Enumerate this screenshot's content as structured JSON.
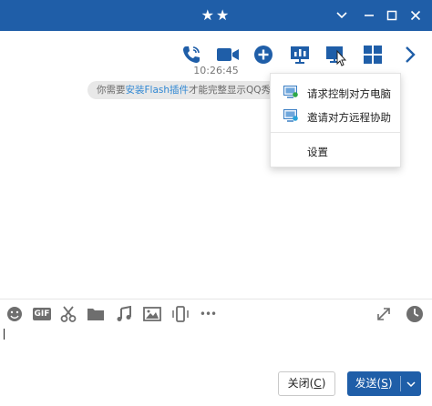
{
  "window": {
    "title": "★★"
  },
  "toolbar": {
    "icons": [
      "phone-icon",
      "video-call-icon",
      "add-icon",
      "presentation-icon",
      "remote-screen-icon",
      "apps-grid-icon",
      "chevron-right-icon"
    ]
  },
  "chat": {
    "timestamp": "10:26:45",
    "tip_prefix": "你需要",
    "tip_link": "安装Flash插件",
    "tip_suffix": "才能完整显示QQ秀"
  },
  "menu": {
    "items": [
      {
        "label": "请求控制对方电脑",
        "icon": "request-control-icon"
      },
      {
        "label": "邀请对方远程协助",
        "icon": "invite-assist-icon"
      },
      {
        "label": "设置"
      }
    ]
  },
  "input_toolbar": {
    "icons": [
      "emoji-icon",
      "gif-icon",
      "scissors-icon",
      "folder-icon",
      "music-icon",
      "image-icon",
      "shake-icon",
      "more-icon",
      "expand-icon",
      "history-clock-icon"
    ],
    "gif_label": "GIF",
    "more_label": "•••"
  },
  "buttons": {
    "close_label": "关闭(",
    "close_key": "C",
    "close_end": ")",
    "send_label": "发送(",
    "send_key": "S",
    "send_end": ")"
  },
  "colors": {
    "accent": "#1f5ea8",
    "link": "#2f87d3"
  }
}
